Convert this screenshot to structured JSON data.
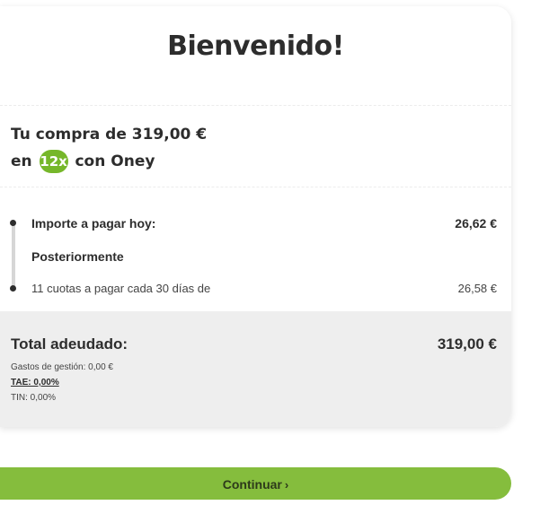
{
  "header": {
    "title": "Bienvenido!"
  },
  "purchase": {
    "line1": "Tu compra de 319,00 €",
    "line2_prefix": "en",
    "installments_badge": "12x",
    "line2_suffix": "con Oney"
  },
  "schedule": {
    "today_label": "Importe a pagar hoy:",
    "today_amount": "26,62 €",
    "later_label": "Posteriormente",
    "installments_label": "11 cuotas a pagar cada 30 días de",
    "installments_amount": "26,58 €"
  },
  "totals": {
    "total_label": "Total adeudado:",
    "total_amount": "319,00 €",
    "fees": "Gastos de gestión: 0,00 €",
    "tae": "TAE: 0,00%",
    "tin": "TIN: 0,00%"
  },
  "actions": {
    "continue_label": "Continuar",
    "continue_icon": "chevron-right-icon"
  },
  "colors": {
    "accent_green": "#85bd3d",
    "badge_green": "#76b72a",
    "summary_bg": "#eeeeee",
    "text_dark": "#2d2d2d"
  }
}
